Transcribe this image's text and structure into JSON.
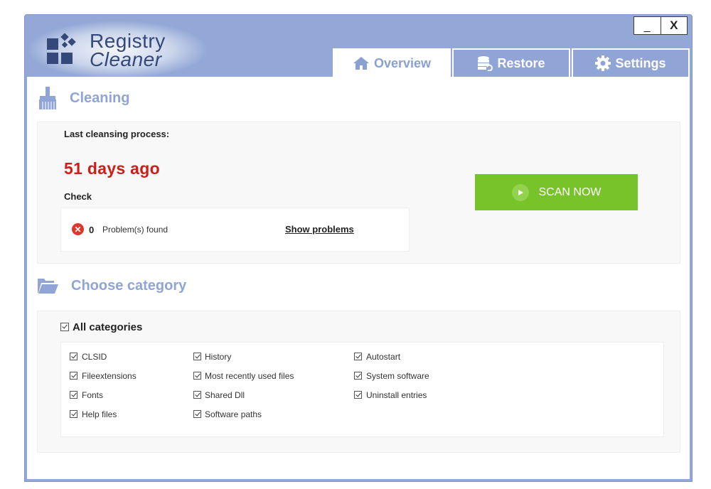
{
  "app": {
    "logo_line1": "Registry",
    "logo_line2": "Cleaner",
    "min_label": "_",
    "close_label": "X",
    "accent": "#93a8d6"
  },
  "tabs": [
    {
      "label": "Overview",
      "icon": "home-icon",
      "active": true
    },
    {
      "label": "Restore",
      "icon": "database-icon",
      "active": false
    },
    {
      "label": "Settings",
      "icon": "gear-icon",
      "active": false
    }
  ],
  "cleaning": {
    "title": "Cleaning",
    "last_label": "Last cleansing process:",
    "last_value": "51 days ago",
    "check_label": "Check",
    "problems_count": "0",
    "problems_label": "Problem(s) found",
    "show_problems": "Show problems",
    "scan_label": "SCAN NOW"
  },
  "category": {
    "title": "Choose category",
    "all_label": "All categories",
    "columns": [
      [
        "CLSID",
        "Fileextensions",
        "Fonts",
        "Help files"
      ],
      [
        "History",
        "Most recently used files",
        "Shared Dll",
        "Software paths"
      ],
      [
        "Autostart",
        "System software",
        "Uninstall entries"
      ]
    ]
  }
}
